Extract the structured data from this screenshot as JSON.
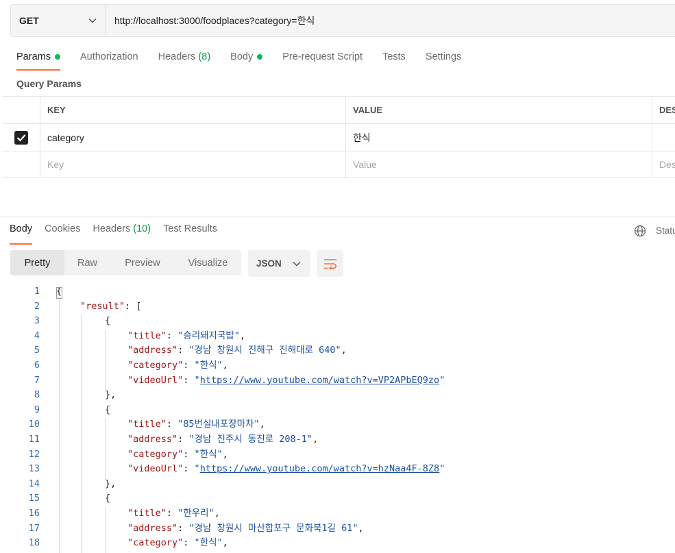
{
  "request": {
    "method": "GET",
    "url": "http://localhost:3000/foodplaces?category=한식"
  },
  "request_tabs": [
    {
      "label": "Params",
      "dot": true,
      "active": true
    },
    {
      "label": "Authorization"
    },
    {
      "label": "Headers",
      "count": "(8)"
    },
    {
      "label": "Body",
      "dot": true
    },
    {
      "label": "Pre-request Script"
    },
    {
      "label": "Tests"
    },
    {
      "label": "Settings"
    }
  ],
  "query_params": {
    "title": "Query Params",
    "headers": {
      "key": "KEY",
      "value": "VALUE",
      "description": "DES"
    },
    "rows": [
      {
        "checked": true,
        "key": "category",
        "value": "한식"
      }
    ],
    "placeholders": {
      "key": "Key",
      "value": "Value",
      "description": "Des"
    }
  },
  "response_tabs": [
    {
      "label": "Body",
      "active": true
    },
    {
      "label": "Cookies"
    },
    {
      "label": "Headers",
      "count": "(10)"
    },
    {
      "label": "Test Results"
    }
  ],
  "status_label": "Statu",
  "view_modes": [
    "Pretty",
    "Raw",
    "Preview",
    "Visualize"
  ],
  "active_view": "Pretty",
  "format": "JSON",
  "colors": {
    "accent": "#ff6c37",
    "dot_green": "#0cbb52",
    "json_key": "#a01515",
    "json_string": "#1a4e9e"
  },
  "code_lines": [
    {
      "n": "1",
      "indent": 0,
      "parts": [
        [
          "p",
          "{"
        ]
      ]
    },
    {
      "n": "2",
      "indent": 1,
      "parts": [
        [
          "k",
          "\"result\""
        ],
        [
          "p",
          ": ["
        ]
      ]
    },
    {
      "n": "3",
      "indent": 2,
      "parts": [
        [
          "p",
          "{"
        ]
      ]
    },
    {
      "n": "4",
      "indent": 3,
      "parts": [
        [
          "k",
          "\"title\""
        ],
        [
          "p",
          ": "
        ],
        [
          "s",
          "\"승리돼지국밥\""
        ],
        [
          "p",
          ","
        ]
      ]
    },
    {
      "n": "5",
      "indent": 3,
      "parts": [
        [
          "k",
          "\"address\""
        ],
        [
          "p",
          ": "
        ],
        [
          "s",
          "\"경남 창원시 진해구 진해대로 640\""
        ],
        [
          "p",
          ","
        ]
      ]
    },
    {
      "n": "6",
      "indent": 3,
      "parts": [
        [
          "k",
          "\"category\""
        ],
        [
          "p",
          ": "
        ],
        [
          "s",
          "\"한식\""
        ],
        [
          "p",
          ","
        ]
      ]
    },
    {
      "n": "7",
      "indent": 3,
      "parts": [
        [
          "k",
          "\"videoUrl\""
        ],
        [
          "p",
          ": "
        ],
        [
          "s",
          "\""
        ],
        [
          "lnk",
          "https://www.youtube.com/watch?v=VP2APbEQ9zo"
        ],
        [
          "s",
          "\""
        ]
      ]
    },
    {
      "n": "8",
      "indent": 2,
      "parts": [
        [
          "p",
          "},"
        ]
      ]
    },
    {
      "n": "9",
      "indent": 2,
      "parts": [
        [
          "p",
          "{"
        ]
      ]
    },
    {
      "n": "10",
      "indent": 3,
      "parts": [
        [
          "k",
          "\"title\""
        ],
        [
          "p",
          ": "
        ],
        [
          "s",
          "\"85번실내포장마차\""
        ],
        [
          "p",
          ","
        ]
      ]
    },
    {
      "n": "11",
      "indent": 3,
      "parts": [
        [
          "k",
          "\"address\""
        ],
        [
          "p",
          ": "
        ],
        [
          "s",
          "\"경남 진주시 동진로 208-1\""
        ],
        [
          "p",
          ","
        ]
      ]
    },
    {
      "n": "12",
      "indent": 3,
      "parts": [
        [
          "k",
          "\"category\""
        ],
        [
          "p",
          ": "
        ],
        [
          "s",
          "\"한식\""
        ],
        [
          "p",
          ","
        ]
      ]
    },
    {
      "n": "13",
      "indent": 3,
      "parts": [
        [
          "k",
          "\"videoUrl\""
        ],
        [
          "p",
          ": "
        ],
        [
          "s",
          "\""
        ],
        [
          "lnk",
          "https://www.youtube.com/watch?v=hzNaa4F-8Z8"
        ],
        [
          "s",
          "\""
        ]
      ]
    },
    {
      "n": "14",
      "indent": 2,
      "parts": [
        [
          "p",
          "},"
        ]
      ]
    },
    {
      "n": "15",
      "indent": 2,
      "parts": [
        [
          "p",
          "{"
        ]
      ]
    },
    {
      "n": "16",
      "indent": 3,
      "parts": [
        [
          "k",
          "\"title\""
        ],
        [
          "p",
          ": "
        ],
        [
          "s",
          "\"한우리\""
        ],
        [
          "p",
          ","
        ]
      ]
    },
    {
      "n": "17",
      "indent": 3,
      "parts": [
        [
          "k",
          "\"address\""
        ],
        [
          "p",
          ": "
        ],
        [
          "s",
          "\"경남 창원시 마산합포구 문화북1길 61\""
        ],
        [
          "p",
          ","
        ]
      ]
    },
    {
      "n": "18",
      "indent": 3,
      "parts": [
        [
          "k",
          "\"category\""
        ],
        [
          "p",
          ": "
        ],
        [
          "s",
          "\"한식\""
        ],
        [
          "p",
          ","
        ]
      ]
    }
  ]
}
